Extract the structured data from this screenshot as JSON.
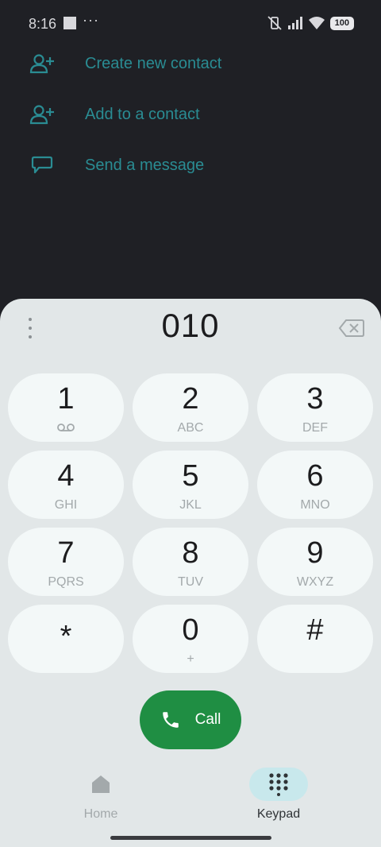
{
  "status_bar": {
    "time": "8:16",
    "extra": "···",
    "battery": "100"
  },
  "actions": [
    {
      "label": "Create new contact",
      "icon": "add-person-icon"
    },
    {
      "label": "Add to a contact",
      "icon": "add-person-icon"
    },
    {
      "label": "Send a message",
      "icon": "message-icon"
    }
  ],
  "dialer": {
    "number": "010"
  },
  "keys": [
    {
      "digit": "1",
      "sub": ""
    },
    {
      "digit": "2",
      "sub": "ABC"
    },
    {
      "digit": "3",
      "sub": "DEF"
    },
    {
      "digit": "4",
      "sub": "GHI"
    },
    {
      "digit": "5",
      "sub": "JKL"
    },
    {
      "digit": "6",
      "sub": "MNO"
    },
    {
      "digit": "7",
      "sub": "PQRS"
    },
    {
      "digit": "8",
      "sub": "TUV"
    },
    {
      "digit": "9",
      "sub": "WXYZ"
    },
    {
      "digit": "*",
      "sub": ""
    },
    {
      "digit": "0",
      "sub": "+"
    },
    {
      "digit": "#",
      "sub": ""
    }
  ],
  "call_button": {
    "label": "Call"
  },
  "nav": {
    "home": "Home",
    "keypad": "Keypad"
  },
  "colors": {
    "accent": "#2a8c93",
    "call": "#1f8e43",
    "sheet": "#e2e7e8",
    "background": "#1f2025"
  }
}
